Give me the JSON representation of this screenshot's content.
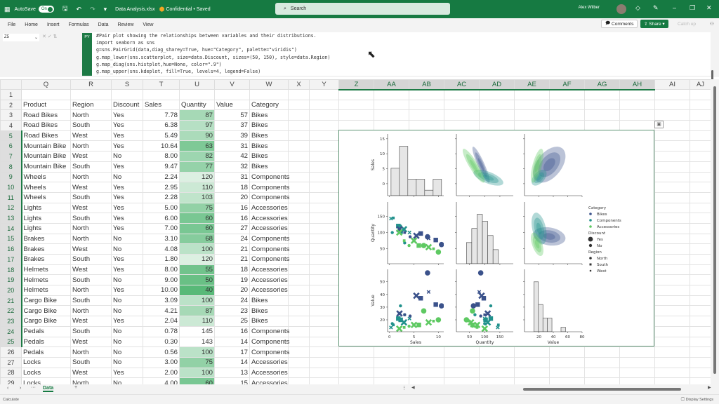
{
  "titlebar": {
    "autosave_label": "AutoSave",
    "autosave_state": "On",
    "filename": "Data Analysis.xlsx",
    "sensitivity": "Confidential • Saved",
    "search_placeholder": "Search",
    "user": "Alex Wilber"
  },
  "menu": [
    "File",
    "Home",
    "Insert",
    "Formulas",
    "Data",
    "Review",
    "View"
  ],
  "ribbon_buttons": {
    "comments": "Comments",
    "share": "Share",
    "catchup": "Catch up"
  },
  "formula_bar": {
    "name_box": "Z5",
    "py_badge": "PY",
    "code": "#Pair plot showing the relationships between variables and their distributions.\nimport seaborn as sns\ng=sns.PairGrid(data,diag_sharey=True, hue=\"Category\", palette=\"viridis\")\ng.map_lower(sns.scatterplot, size=data.Discount, sizes=(50, 150), style=data.Region)\ng.map_diag(sns.histplot,hue=None, color=\".9\")\ng.map_upper(sns.kdeplot, fill=True, levels=4, legend=False)"
  },
  "sheet": {
    "columns": [
      "Q",
      "R",
      "S",
      "T",
      "U",
      "V",
      "W",
      "X",
      "Y",
      "Z",
      "AA",
      "AB",
      "AC",
      "AD",
      "AE",
      "AF",
      "AG",
      "AH",
      "AI",
      "AJ"
    ],
    "selected_columns": [
      "Z",
      "AA",
      "AB",
      "AC",
      "AD",
      "AE",
      "AF",
      "AG",
      "AH"
    ],
    "headers": [
      "Product",
      "Region",
      "Discount",
      "Sales",
      "Quantity",
      "Value",
      "Category"
    ],
    "rows": [
      [
        "Road Bikes",
        "North",
        "Yes",
        "7.78",
        87,
        57,
        "Bikes"
      ],
      [
        "Road Bikes",
        "South",
        "Yes",
        "6.38",
        97,
        37,
        "Bikes"
      ],
      [
        "Road Bikes",
        "West",
        "Yes",
        "5.49",
        90,
        39,
        "Bikes"
      ],
      [
        "Mountain Bike",
        "North",
        "Yes",
        "10.64",
        63,
        31,
        "Bikes"
      ],
      [
        "Mountain Bike",
        "West",
        "No",
        "8.00",
        82,
        42,
        "Bikes"
      ],
      [
        "Mountain Bike",
        "South",
        "Yes",
        "9.47",
        77,
        32,
        "Bikes"
      ],
      [
        "Wheels",
        "North",
        "No",
        "2.24",
        120,
        31,
        "Components"
      ],
      [
        "Wheels",
        "West",
        "Yes",
        "2.95",
        110,
        18,
        "Components"
      ],
      [
        "Wheels",
        "South",
        "Yes",
        "2.28",
        103,
        20,
        "Components"
      ],
      [
        "Lights",
        "West",
        "Yes",
        "5.00",
        75,
        16,
        "Accessories"
      ],
      [
        "Lights",
        "South",
        "Yes",
        "6.00",
        60,
        16,
        "Accessories"
      ],
      [
        "Lights",
        "North",
        "Yes",
        "7.00",
        60,
        27,
        "Accessories"
      ],
      [
        "Brakes",
        "North",
        "No",
        "3.10",
        68,
        24,
        "Components"
      ],
      [
        "Brakes",
        "West",
        "No",
        "4.08",
        100,
        21,
        "Components"
      ],
      [
        "Brakes",
        "South",
        "Yes",
        "1.80",
        120,
        21,
        "Components"
      ],
      [
        "Helmets",
        "West",
        "Yes",
        "8.00",
        55,
        18,
        "Accessories"
      ],
      [
        "Helmets",
        "South",
        "No",
        "9.00",
        50,
        19,
        "Accessories"
      ],
      [
        "Helmets",
        "North",
        "Yes",
        "10.00",
        40,
        20,
        "Accessories"
      ],
      [
        "Cargo Bike",
        "South",
        "No",
        "3.09",
        100,
        24,
        "Bikes"
      ],
      [
        "Cargo Bike",
        "North",
        "No",
        "4.21",
        87,
        23,
        "Bikes"
      ],
      [
        "Cargo Bike",
        "West",
        "Yes",
        "2.04",
        110,
        25,
        "Bikes"
      ],
      [
        "Pedals",
        "South",
        "No",
        "0.78",
        145,
        16,
        "Components"
      ],
      [
        "Pedals",
        "West",
        "No",
        "0.30",
        143,
        14,
        "Components"
      ],
      [
        "Pedals",
        "North",
        "No",
        "0.56",
        100,
        17,
        "Components"
      ],
      [
        "Locks",
        "South",
        "No",
        "3.00",
        75,
        14,
        "Accessories"
      ],
      [
        "Locks",
        "West",
        "Yes",
        "2.00",
        100,
        13,
        "Accessories"
      ],
      [
        "Locks",
        "North",
        "No",
        "4.00",
        60,
        15,
        "Accessories"
      ]
    ],
    "unshaded_quantity_rows": [
      24,
      25
    ],
    "sheet_tabs": [
      "Data"
    ],
    "active_tab": "Data"
  },
  "status": {
    "left": "Calculate",
    "right": "Display Settings"
  },
  "chart_data": {
    "type": "pairplot",
    "variables": [
      "Sales",
      "Quantity",
      "Value"
    ],
    "hue": "Category",
    "palette": {
      "Bikes": "#3b528b",
      "Components": "#21918c",
      "Accessories": "#5ec962"
    },
    "x_range": {
      "Sales": [
        -0.4,
        11.1
      ],
      "Quantity": [
        7,
        194
      ],
      "Value": [
        0,
        80
      ]
    },
    "y_range": {
      "Sales": [
        -4,
        16.6
      ],
      "Quantity": [
        4,
        194
      ],
      "Value": [
        10.6,
        59.8
      ]
    },
    "x_ticks": {
      "Sales": [
        0,
        5,
        10
      ],
      "Quantity": [
        50,
        100,
        150
      ],
      "Value": [
        20,
        40,
        60,
        80
      ]
    },
    "y_ticks": {
      "Sales": [
        0,
        5,
        10,
        15
      ],
      "Quantity": [
        50,
        100,
        150
      ],
      "Value": [
        20,
        30,
        40,
        50
      ]
    },
    "diag_hist": {
      "Sales": {
        "edges": [
          0.3,
          2.02,
          3.74,
          5.47,
          7.19,
          8.92,
          10.64
        ],
        "counts": [
          5,
          9,
          3,
          3,
          1,
          3
        ]
      },
      "Quantity": {
        "edges": [
          40,
          57.5,
          75,
          92.5,
          110,
          127.5,
          145
        ],
        "counts": [
          3,
          5,
          7,
          6,
          4,
          2
        ]
      },
      "Value": {
        "edges": [
          13,
          19.3,
          25.6,
          31.9,
          38.1,
          44.4,
          50.7,
          57
        ],
        "counts": [
          11,
          6,
          3,
          3,
          0,
          0,
          1
        ]
      }
    },
    "legend": {
      "category_title": "Category",
      "categories": [
        "Bikes",
        "Components",
        "Accessories"
      ],
      "discount_title": "Discount",
      "discount": [
        "Yes",
        "No"
      ],
      "region_title": "Region",
      "regions": [
        "North",
        "South",
        "West"
      ],
      "position": "right"
    },
    "lower": "scatter",
    "upper": "kde",
    "diag": "hist"
  }
}
